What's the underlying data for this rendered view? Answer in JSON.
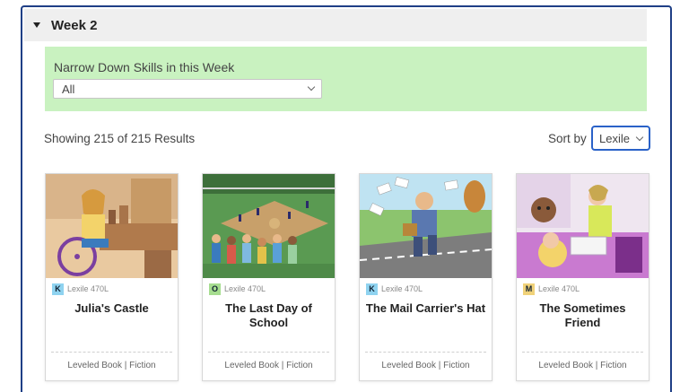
{
  "week": {
    "title": "Week 2"
  },
  "filter": {
    "label": "Narrow Down Skills in this Week",
    "selected": "All"
  },
  "results": {
    "summary": "Showing 215 of 215 Results",
    "sort_label": "Sort by",
    "sort_value": "Lexile"
  },
  "books": [
    {
      "title": "Julia's Castle",
      "level": "K",
      "level_color": "#8fd3f0",
      "lexile": "Lexile 470L",
      "footer": "Leveled Book | Fiction"
    },
    {
      "title": "The Last Day of School",
      "level": "O",
      "level_color": "#a6dd8f",
      "lexile": "Lexile 470L",
      "footer": "Leveled Book | Fiction"
    },
    {
      "title": "The Mail Carrier's Hat",
      "level": "K",
      "level_color": "#8fd3f0",
      "lexile": "Lexile 470L",
      "footer": "Leveled Book | Fiction"
    },
    {
      "title": "The Sometimes Friend",
      "level": "M",
      "level_color": "#f0d27a",
      "lexile": "Lexile 470L",
      "footer": "Leveled Book | Fiction"
    }
  ]
}
